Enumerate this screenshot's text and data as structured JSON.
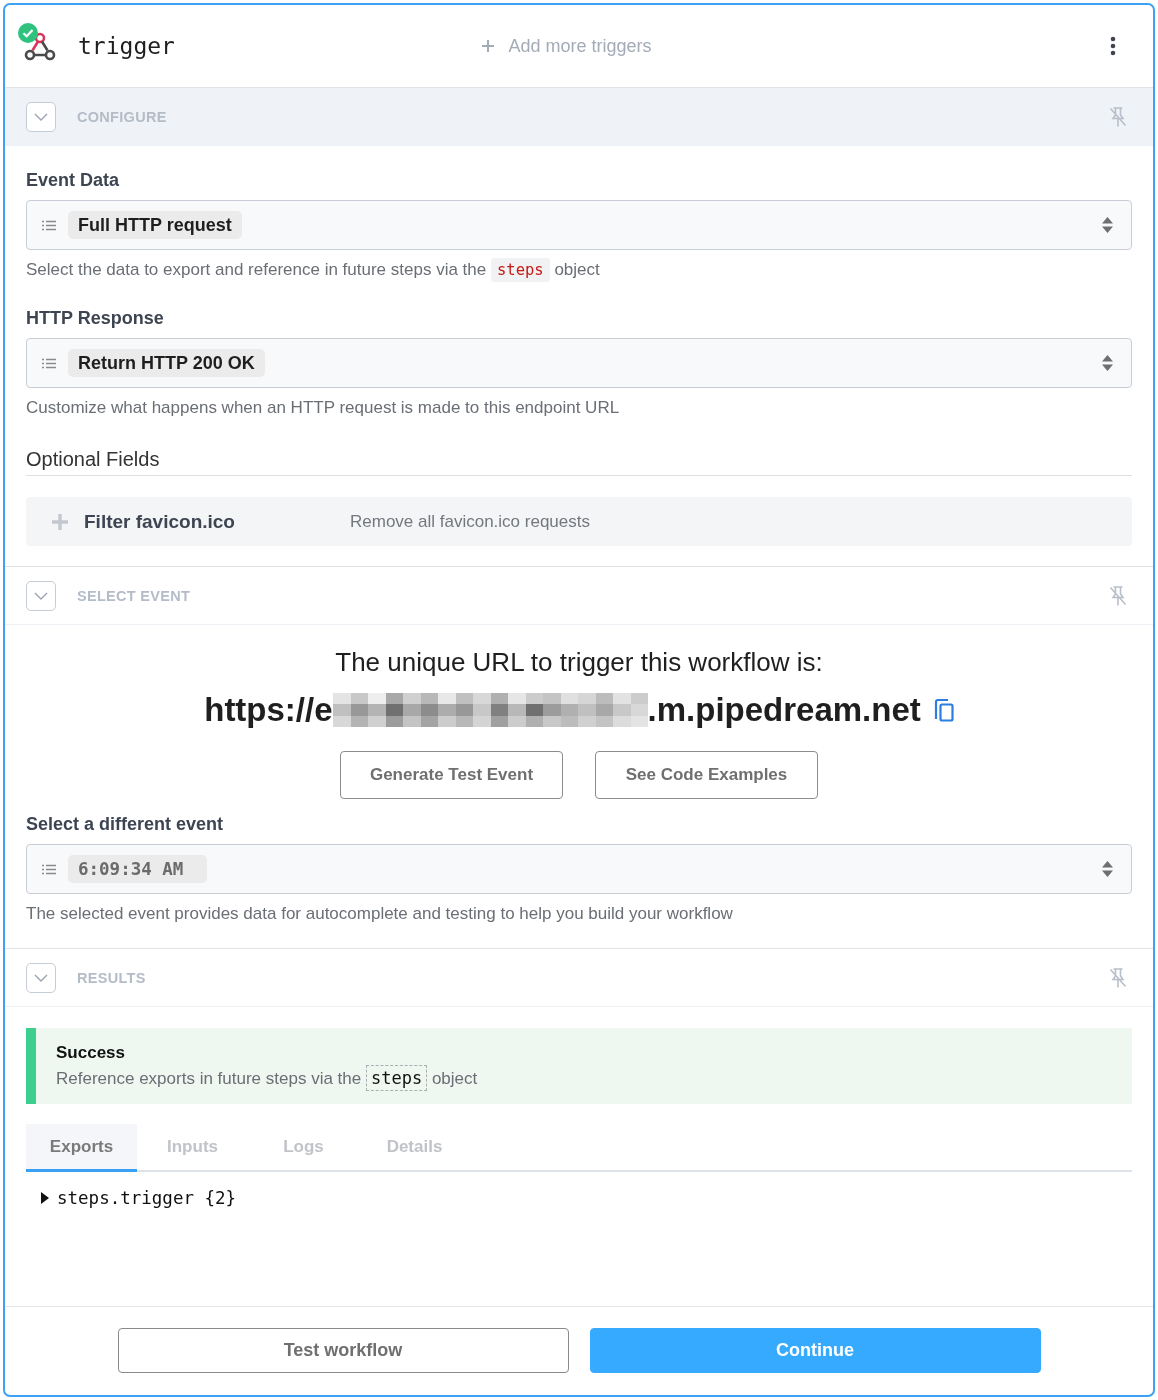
{
  "header": {
    "title": "trigger",
    "add_trigger_label": "Add more triggers"
  },
  "sections": [
    {
      "kind": "configure",
      "title": "CONFIGURE",
      "highlighted": true,
      "fields": [
        {
          "label": "Event Data",
          "value": "Full HTTP request",
          "help": [
            {
              "kind": "text",
              "text": "Select the data to export and reference in future steps via the"
            },
            {
              "kind": "code",
              "text": "steps"
            },
            {
              "kind": "text",
              "text": "object"
            }
          ]
        },
        {
          "label": "HTTP Response",
          "value": "Return HTTP 200 OK",
          "help": [
            {
              "kind": "text",
              "text": "Customize what happens when an HTTP request is made to this endpoint URL"
            }
          ]
        }
      ],
      "optional_fields": {
        "title": "Optional Fields",
        "items": [
          {
            "name": "Filter favicon.ico",
            "description": "Remove all favicon.ico requests"
          }
        ]
      }
    },
    {
      "kind": "select_event",
      "title": "SELECT EVENT",
      "highlighted": false,
      "intro": "The unique URL to trigger this workflow is:",
      "url_start": "https://e",
      "url_end": ".m.pipedream.net",
      "buttons": [
        "Generate Test Event",
        "See Code Examples"
      ],
      "event_field": {
        "label": "Select a different event",
        "value": "6:09:34 AM",
        "help": "The selected event provides data for autocomplete and testing to help you build your workflow"
      }
    },
    {
      "kind": "results",
      "title": "RESULTS",
      "highlighted": false,
      "alert": {
        "kind": "success",
        "title": "Success",
        "message": [
          {
            "kind": "text",
            "text": "Reference exports in future steps via the"
          },
          {
            "kind": "code",
            "text": "steps"
          },
          {
            "kind": "text",
            "text": "object"
          }
        ]
      },
      "tabs": [
        {
          "label": "Exports",
          "selected": true
        },
        {
          "label": "Inputs",
          "selected": false
        },
        {
          "label": "Logs",
          "selected": false
        },
        {
          "label": "Details",
          "selected": false
        }
      ],
      "tree": [
        {
          "label": "steps.trigger {2}",
          "expanded": false
        }
      ]
    }
  ],
  "footer": {
    "buttons": [
      {
        "label": "Test workflow",
        "kind": "secondary"
      },
      {
        "label": "Continue",
        "kind": "primary"
      }
    ]
  }
}
